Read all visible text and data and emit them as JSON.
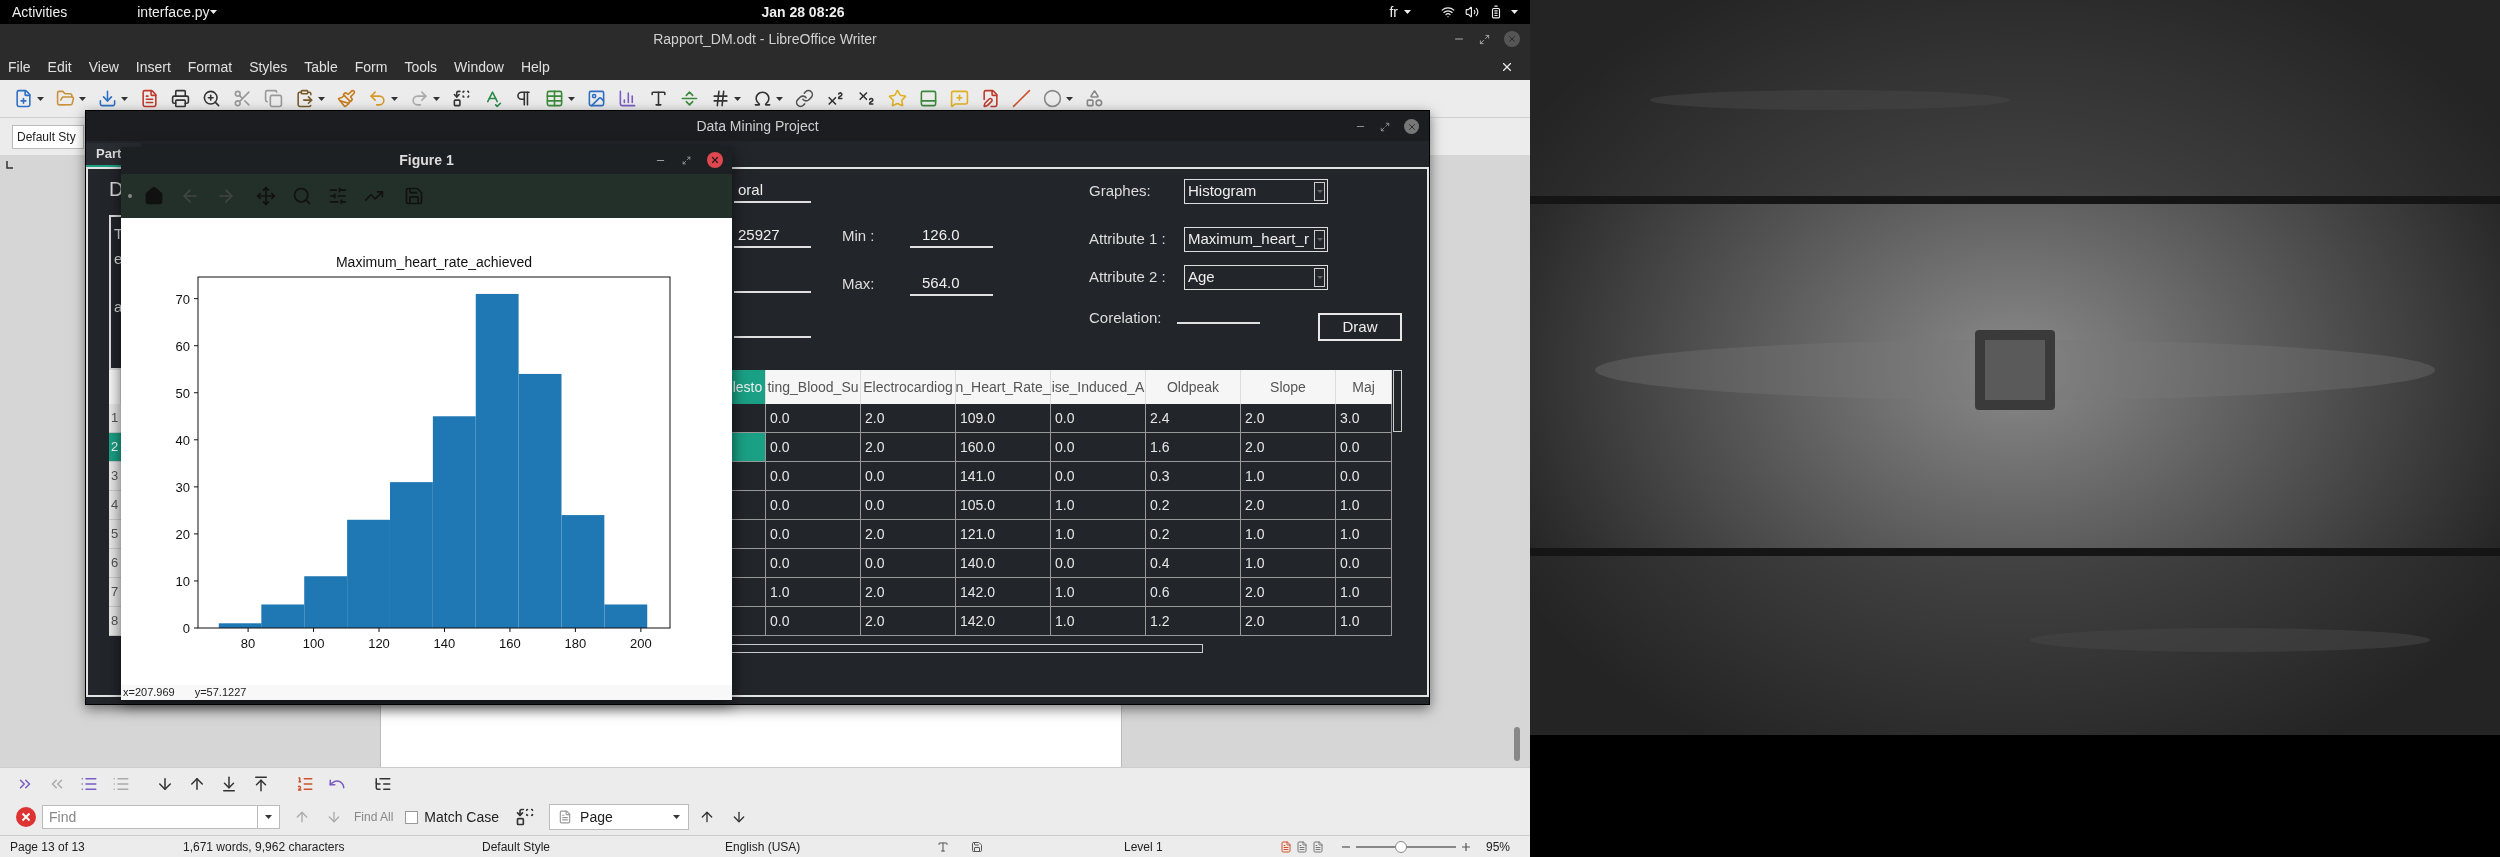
{
  "top_bar": {
    "activities": "Activities",
    "app_menu": "interface.py",
    "clock": "Jan 28  08:26",
    "keyboard_layout": "fr"
  },
  "writer": {
    "title": "Rapport_DM.odt - LibreOffice Writer",
    "menu": [
      "File",
      "Edit",
      "View",
      "Insert",
      "Format",
      "Styles",
      "Table",
      "Form",
      "Tools",
      "Window",
      "Help"
    ],
    "paragraph_style": "Default Sty",
    "find_bar": {
      "placeholder": "Find",
      "find_all": "Find All",
      "match_case": {
        "label": "Match Case",
        "checked": false
      },
      "navigate_by": "Page"
    },
    "status_bar": {
      "page": "Page 13 of 13",
      "words": "1,671 words, 9,962 characters",
      "page_style": "Default Style",
      "language": "English (USA)",
      "outline_level": "Level 1",
      "zoom": "95%",
      "zoom_slider": {
        "level": 0.45
      }
    }
  },
  "data_mining_window": {
    "title": "Data Mining Project",
    "tabs": [
      {
        "label": "Part",
        "selected": true
      }
    ],
    "heading": "D",
    "text_box_lines": [
      "T",
      "e",
      "a"
    ],
    "fields": [
      "oral",
      "25927"
    ],
    "min": {
      "label": "Min :",
      "value": "126.0"
    },
    "max": {
      "label": "Max:",
      "value": "564.0"
    },
    "graph_type": {
      "label": "Graphes:",
      "value": "Histogram"
    },
    "attribute_1": {
      "label": "Attribute 1 :",
      "value": "Maximum_heart_r"
    },
    "attribute_2": {
      "label": "Attribute 2 :",
      "value": "Age"
    },
    "correlation": {
      "label": "Corelation:"
    },
    "draw_button": "Draw",
    "table": {
      "columns": [
        {
          "label": "lesto",
          "selected": true
        },
        {
          "label": "ting_Blood_Su",
          "selected": false
        },
        {
          "label": "Electrocardiog",
          "selected": false
        },
        {
          "label": "n_Heart_Rate_",
          "selected": false
        },
        {
          "label": "ise_Induced_A",
          "selected": false
        },
        {
          "label": "Oldpeak",
          "selected": false
        },
        {
          "label": "Slope",
          "selected": false
        },
        {
          "label": "Maj",
          "selected": false
        }
      ],
      "rows": [
        {
          "header": "1",
          "selected": false,
          "cells": [
            "",
            "0.0",
            "2.0",
            "109.0",
            "0.0",
            "2.4",
            "2.0",
            "3.0"
          ]
        },
        {
          "header": "2",
          "selected": true,
          "cells": [
            "",
            "0.0",
            "2.0",
            "160.0",
            "0.0",
            "1.6",
            "2.0",
            "0.0"
          ]
        },
        {
          "header": "3",
          "selected": false,
          "cells": [
            "",
            "0.0",
            "0.0",
            "141.0",
            "0.0",
            "0.3",
            "1.0",
            "0.0"
          ]
        },
        {
          "header": "4",
          "selected": false,
          "cells": [
            "",
            "0.0",
            "0.0",
            "105.0",
            "1.0",
            "0.2",
            "2.0",
            "1.0"
          ]
        },
        {
          "header": "5",
          "selected": false,
          "cells": [
            "",
            "0.0",
            "2.0",
            "121.0",
            "1.0",
            "0.2",
            "1.0",
            "1.0"
          ]
        },
        {
          "header": "6",
          "selected": false,
          "cells": [
            "",
            "0.0",
            "0.0",
            "140.0",
            "0.0",
            "0.4",
            "1.0",
            "0.0"
          ]
        },
        {
          "header": "7",
          "selected": false,
          "cells": [
            "",
            "1.0",
            "2.0",
            "142.0",
            "1.0",
            "0.6",
            "2.0",
            "1.0"
          ]
        },
        {
          "header": "8",
          "selected": false,
          "cells": [
            "",
            "0.0",
            "2.0",
            "142.0",
            "1.0",
            "1.2",
            "2.0",
            "1.0"
          ]
        }
      ]
    }
  },
  "figure_window": {
    "title": "Figure 1",
    "cursor_x": "x=207.969",
    "cursor_y": "y=57.1227",
    "chart_data": {
      "type": "bar",
      "title": "Maximum_heart_rate_achieved",
      "x": [
        77.6,
        90.6,
        103.7,
        116.8,
        129.9,
        143.0,
        156.1,
        169.2,
        182.3,
        195.4
      ],
      "series": [
        {
          "color": "#1f77b4",
          "values": [
            1,
            5,
            11,
            23,
            31,
            45,
            71,
            54,
            24,
            5
          ]
        }
      ],
      "xlim": [
        64.7,
        208.9
      ],
      "ylim": [
        0,
        74.6
      ],
      "xticks": [
        80,
        100,
        120,
        140,
        160,
        180,
        200
      ],
      "yticks": [
        0,
        10,
        20,
        30,
        40,
        50,
        60,
        70
      ]
    }
  }
}
